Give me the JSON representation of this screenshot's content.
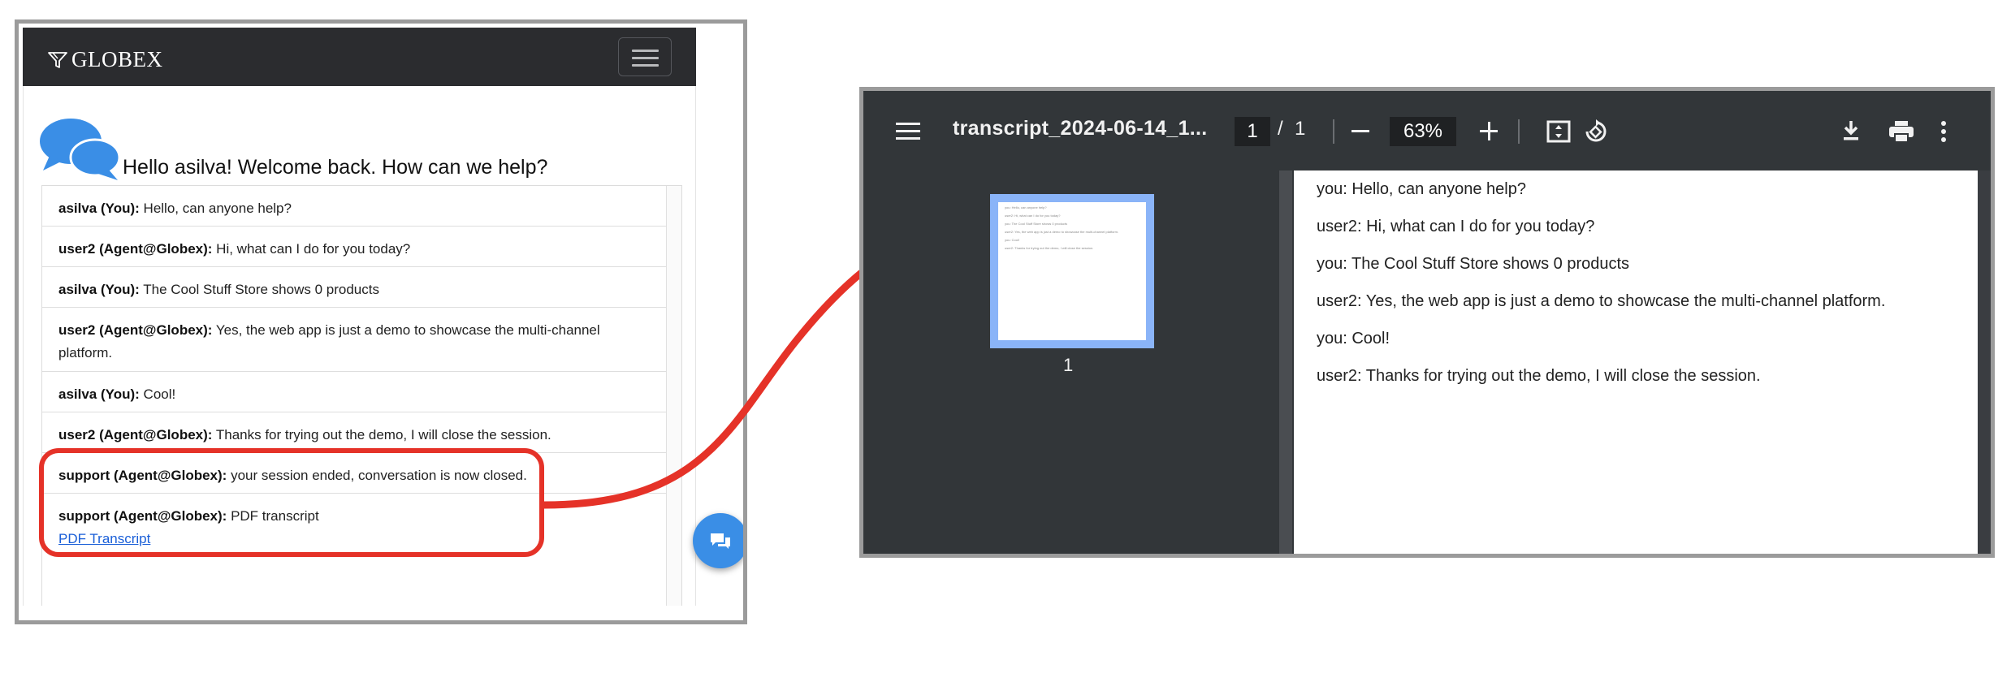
{
  "chat_app": {
    "brand": "GLOBEX",
    "welcome": "Hello asilva! Welcome back. How can we help?",
    "messages": [
      {
        "sender": "asilva (You):",
        "text": " Hello, can anyone help?"
      },
      {
        "sender": "user2 (Agent@Globex):",
        "text": " Hi, what can I do for you today?"
      },
      {
        "sender": "asilva (You):",
        "text": " The Cool Stuff Store shows 0 products"
      },
      {
        "sender": "user2 (Agent@Globex):",
        "text": " Yes, the web app is just a demo to showcase the multi-channel platform."
      },
      {
        "sender": "asilva (You):",
        "text": " Cool!"
      },
      {
        "sender": "user2 (Agent@Globex):",
        "text": " Thanks for trying out the demo, I will close the session."
      },
      {
        "sender": "support (Agent@Globex):",
        "text": " your session ended, conversation is now closed."
      },
      {
        "sender": "support (Agent@Globex):",
        "text": " PDF transcript",
        "link": "PDF Transcript"
      }
    ],
    "colors": {
      "navbar": "#2b2c2f",
      "fab": "#3a8ee6",
      "link": "#1a5fd8",
      "highlight": "#e53228"
    },
    "icons": [
      "filter-logo-icon",
      "hamburger-icon",
      "chat-bubbles-icon",
      "chat-fab-icon"
    ]
  },
  "pdf_viewer": {
    "title": "transcript_2024-06-14_1...",
    "page_current": "1",
    "page_separator": "/",
    "page_total": "1",
    "zoom": "63%",
    "thumbnail_label": "1",
    "lines": [
      "you: Hello, can anyone help?",
      "user2: Hi, what can I do for you today?",
      "you: The Cool Stuff Store shows 0 products",
      "user2: Yes, the web app is just a demo to showcase the multi-channel platform.",
      "you: Cool!",
      "user2: Thanks for trying out the demo, I will close the session."
    ],
    "icons": [
      "menu-icon",
      "zoom-out-icon",
      "zoom-in-icon",
      "fit-page-icon",
      "rotate-icon",
      "download-icon",
      "print-icon",
      "more-vert-icon"
    ]
  }
}
